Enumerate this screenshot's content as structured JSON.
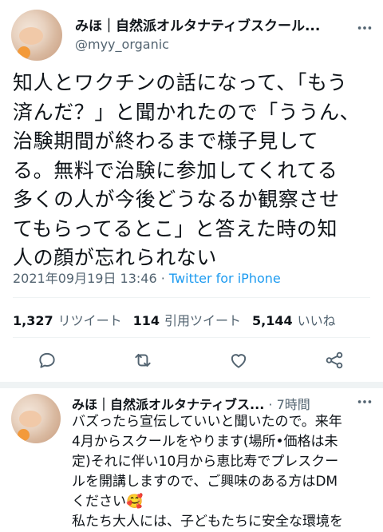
{
  "main_tweet": {
    "display_name": "みほ｜自然派オルタナティブスクール...",
    "handle": "@myy_organic",
    "text_lines": [
      "知人とワクチンの話になって、「もう",
      "済んだ？」と聞かれたので「ううん、",
      "治験期間が終わるまで様子見して",
      "る。無料で治験に参加してくれてる",
      "多くの人が今後どうなるか観察させ",
      "てもらってるとこ」と答えた時の知",
      "人の顔が忘れられない"
    ],
    "timestamp": "2021年09月19日 13:46",
    "separator": "·",
    "source": "Twitter for iPhone",
    "stats": {
      "retweets_count": "1,327",
      "retweets_label": "リツイート",
      "quotes_count": "114",
      "quotes_label": "引用ツイート",
      "likes_count": "5,144",
      "likes_label": "いいね"
    }
  },
  "reply_tweet": {
    "display_name": "みほ｜自然派オルタナティブス...",
    "separator": "·",
    "time": "7時間",
    "text_lines": [
      "バズったら宣伝していいと聞いたので。来年",
      "4月からスクールをやります(場所•価格は未",
      "定)それに伴い10月から恵比寿でプレスクー",
      "ルを開講しますので、ご興味のある方はDM",
      "ください🥰",
      "私たち大人には、子どもたちに安全な環境を"
    ]
  },
  "icons": [
    "more-icon",
    "reply-icon",
    "retweet-icon",
    "like-icon",
    "share-icon"
  ],
  "colors": {
    "link": "#1d9bf0",
    "secondary": "#536471",
    "text": "#0f1419",
    "divider": "#eff3f4"
  }
}
